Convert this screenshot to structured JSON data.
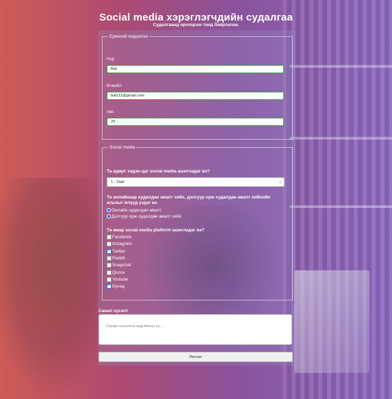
{
  "page": {
    "title": "Social media хэрэглэгчдийн судалгаа",
    "subtitle": "Судалгаанд оролцсон танд баярлалаа."
  },
  "general": {
    "legend": "Ерөнхий мэдээлэл",
    "name_label": "Нэр",
    "name_value": "Bat",
    "email_label": "И-мэйл",
    "email_value": "bat111@gmail.com",
    "age_label": "нас",
    "age_value": "29"
  },
  "social": {
    "legend": "Social media",
    "time_question": "Та өдөрт хэдэн цаг social media ашигладаг вэ?",
    "time_selected": "1 - 2цаг",
    "purchase_question": "Та онлайнаар худалдан авалт хийх, дэлгүүр орж худалдан авалт хийхийн альныг илүүд үздэг вэ",
    "purchase_options": [
      "Онлайн худалдан авалт",
      "Дэлгүүр орж худалдан авалт хийх"
    ],
    "platform_question": "Та ямар social media platform ашигладаг вэ?",
    "platforms": [
      {
        "label": "Facebook",
        "checked": false
      },
      {
        "label": "Instagram",
        "checked": false
      },
      {
        "label": "Twitter",
        "checked": true
      },
      {
        "label": "Reddit",
        "checked": false
      },
      {
        "label": "Snapchat",
        "checked": false
      },
      {
        "label": "Quora",
        "checked": false
      },
      {
        "label": "Youtube",
        "checked": false
      },
      {
        "label": "Бусад",
        "checked": true
      }
    ]
  },
  "feedback": {
    "label": "Санал хүсэлт",
    "placeholder": "Санал хүсэлтээ энд бичнэ үү...."
  },
  "submit_label": "Илгээх",
  "colors": {
    "input_border": "#3f9c45",
    "accent": "#2a6cf0"
  }
}
